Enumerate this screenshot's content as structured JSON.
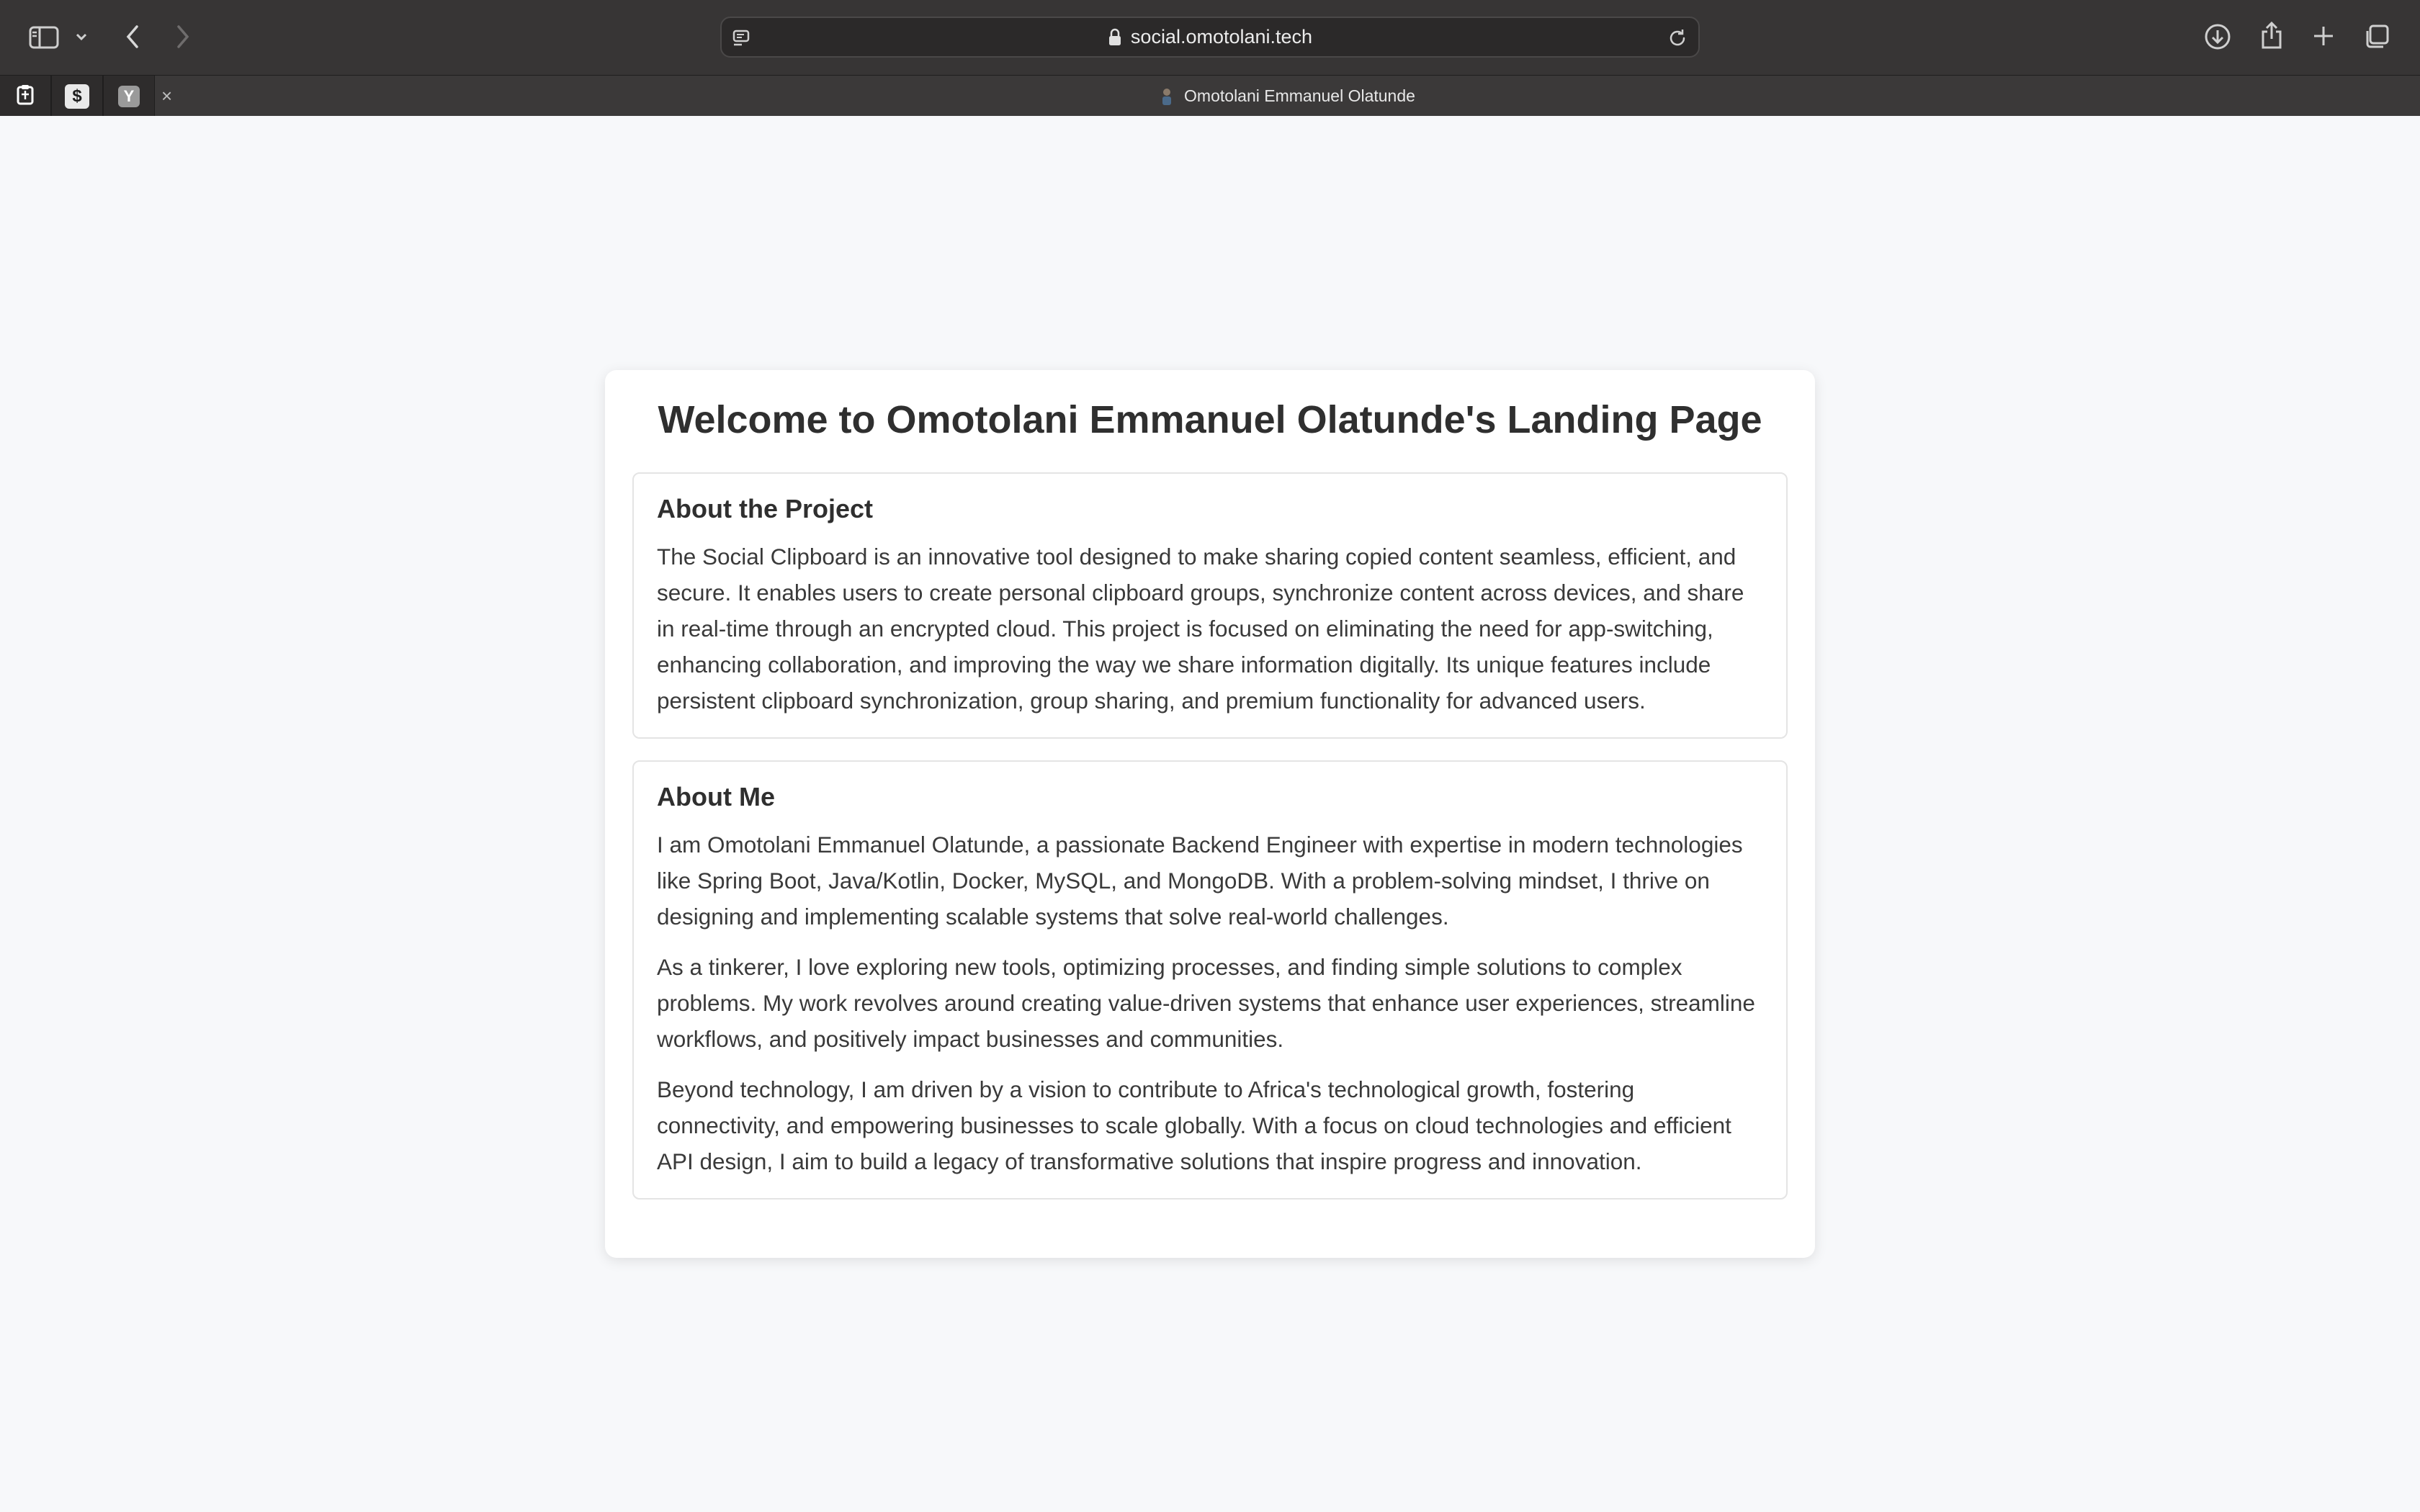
{
  "browser": {
    "url": "social.omotolani.tech",
    "active_tab_title": "Omotolani Emmanuel Olatunde",
    "pinned_tabs": [
      {
        "icon": "clipboard-icon",
        "glyph": ""
      },
      {
        "icon": "dollar-terminal-icon",
        "glyph": "$"
      },
      {
        "icon": "y-combinator-icon",
        "glyph": "Y"
      }
    ]
  },
  "page": {
    "title": "Welcome to Omotolani Emmanuel Olatunde's Landing Page",
    "project": {
      "heading": "About the Project",
      "body": "The Social Clipboard is an innovative tool designed to make sharing copied content seamless, efficient, and secure. It enables users to create personal clipboard groups, synchronize content across devices, and share in real-time through an encrypted cloud. This project is focused on eliminating the need for app-switching, enhancing collaboration, and improving the way we share information digitally. Its unique features include persistent clipboard synchronization, group sharing, and premium functionality for advanced users."
    },
    "about": {
      "heading": "About Me",
      "paragraphs": [
        "I am Omotolani Emmanuel Olatunde, a passionate Backend Engineer with expertise in modern technologies like Spring Boot, Java/Kotlin, Docker, MySQL, and MongoDB. With a problem-solving mindset, I thrive on designing and implementing scalable systems that solve real-world challenges.",
        "As a tinkerer, I love exploring new tools, optimizing processes, and finding simple solutions to complex problems. My work revolves around creating value-driven systems that enhance user experiences, streamline workflows, and positively impact businesses and communities.",
        "Beyond technology, I am driven by a vision to contribute to Africa's technological growth, fostering connectivity, and empowering businesses to scale globally. With a focus on cloud technologies and efficient API design, I aim to build a legacy of transformative solutions that inspire progress and innovation."
      ]
    }
  },
  "colors": {
    "chrome_bg": "#373535",
    "page_bg": "#f7f8fa",
    "card_bg": "#ffffff",
    "text": "#3a3a3a"
  }
}
